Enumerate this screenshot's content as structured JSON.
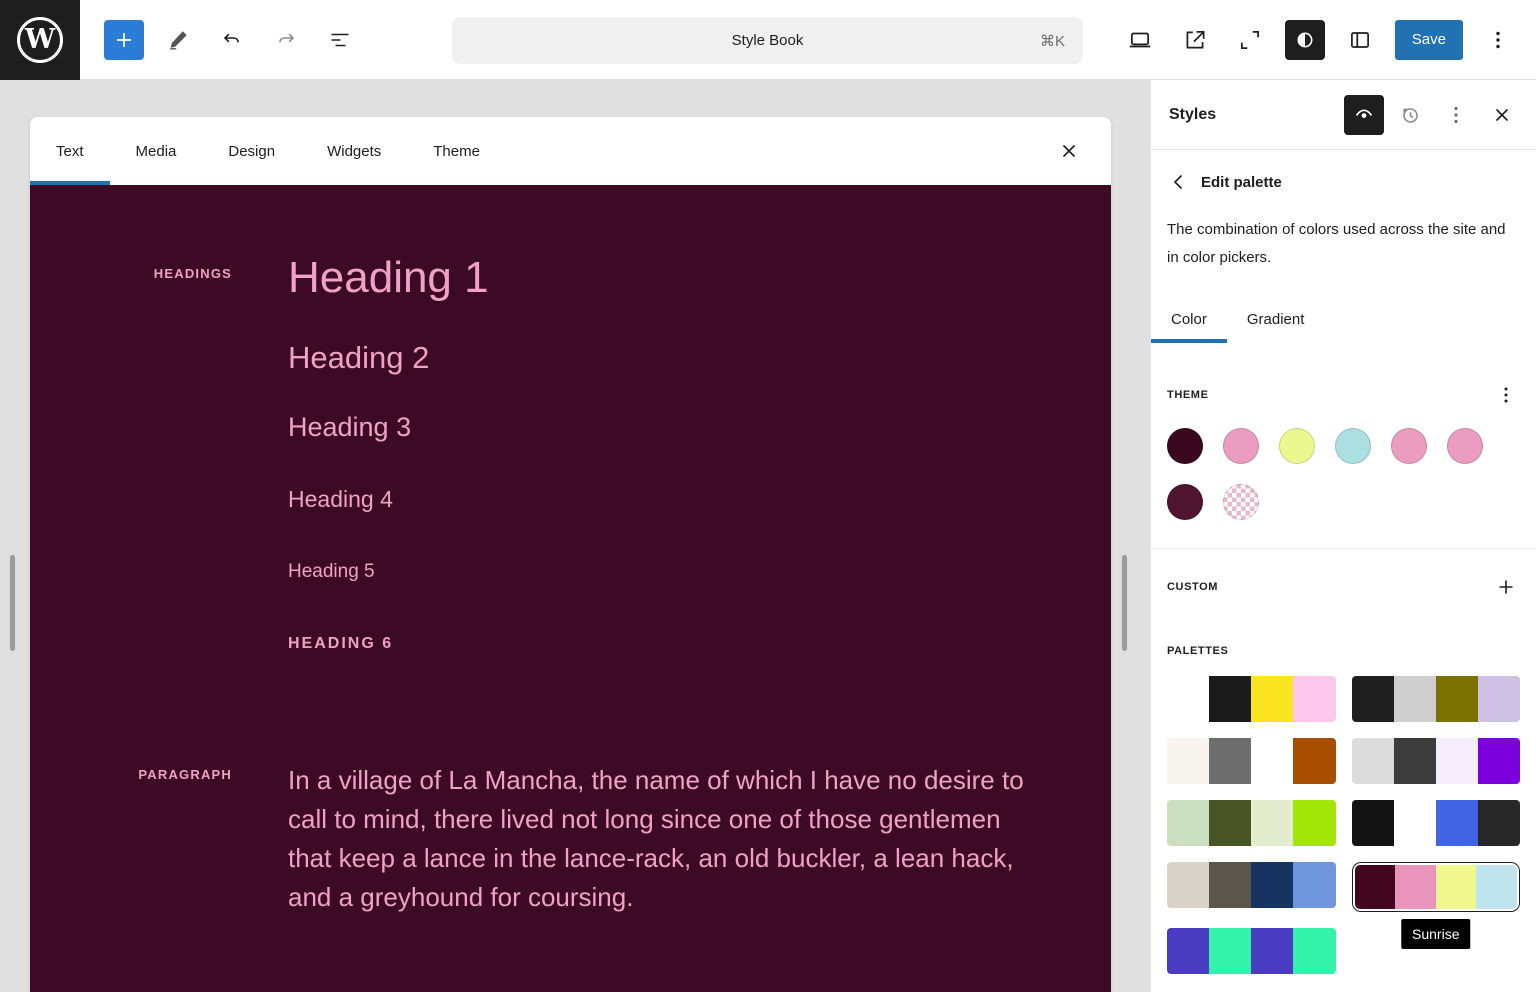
{
  "topbar": {
    "command_bar": {
      "title": "Style Book",
      "shortcut": "⌘K"
    },
    "save_label": "Save",
    "wp_mark": "W"
  },
  "stylebook": {
    "tabs": [
      "Text",
      "Media",
      "Design",
      "Widgets",
      "Theme"
    ],
    "active_tab": "Text",
    "headings_label": "Headings",
    "headings": [
      "Heading 1",
      "Heading 2",
      "Heading 3",
      "Heading 4",
      "Heading 5",
      "HEADING 6"
    ],
    "paragraph_label": "Paragraph",
    "paragraph": "In a village of La Mancha, the name of which I have no desire to call to mind, there lived not long since one of those gentlemen that keep a lance in the lance-rack, an old buckler, a lean hack, and a greyhound for coursing.",
    "colors": {
      "background": "#3d0a26",
      "text": "#f0a1c4"
    }
  },
  "sidebar": {
    "title": "Styles",
    "back_label": "Edit palette",
    "description": "The combination of colors used across the site and in color pickers.",
    "tabs": [
      "Color",
      "Gradient"
    ],
    "active_tab": "Color",
    "theme": {
      "label": "Theme",
      "swatches": [
        "#3a081e",
        "#eb9dbf",
        "#ebf78f",
        "#abdfe2",
        "#eb9dbf",
        "#eb9dbf",
        "#4f1430",
        "pattern"
      ]
    },
    "custom_label": "Custom",
    "palettes_label": "Palettes",
    "palettes": [
      {
        "colors": [
          "#ffffff",
          "#1a1a1a",
          "#fae520",
          "#fbc8ec"
        ]
      },
      {
        "colors": [
          "#1f1f1f",
          "#cfcfcf",
          "#7a7100",
          "#cdc2e5"
        ]
      },
      {
        "colors": [
          "#f8f5f0",
          "#6e6e6e",
          "#ffffff",
          "#a84e03"
        ]
      },
      {
        "colors": [
          "#dcdcdc",
          "#3d3d3d",
          "#f8eefb",
          "#7d00de"
        ]
      },
      {
        "colors": [
          "#ccdfc0",
          "#485423",
          "#e3eccf",
          "#a4e608"
        ]
      },
      {
        "colors": [
          "#131313",
          "#ffffff",
          "#4164e4",
          "#272727"
        ]
      },
      {
        "colors": [
          "#d8d2c9",
          "#5c554b",
          "#17335f",
          "#6d96dc"
        ]
      },
      {
        "colors": [
          "#42071f",
          "#e994ba",
          "#eff78d",
          "#bfe4ee"
        ],
        "selected": true,
        "tooltip": "Sunrise"
      },
      {
        "colors": [
          "#4a3bc0",
          "#33f2a9",
          "#4a3bc0",
          "#33f2a9"
        ]
      }
    ],
    "accent": "#2271b1"
  }
}
